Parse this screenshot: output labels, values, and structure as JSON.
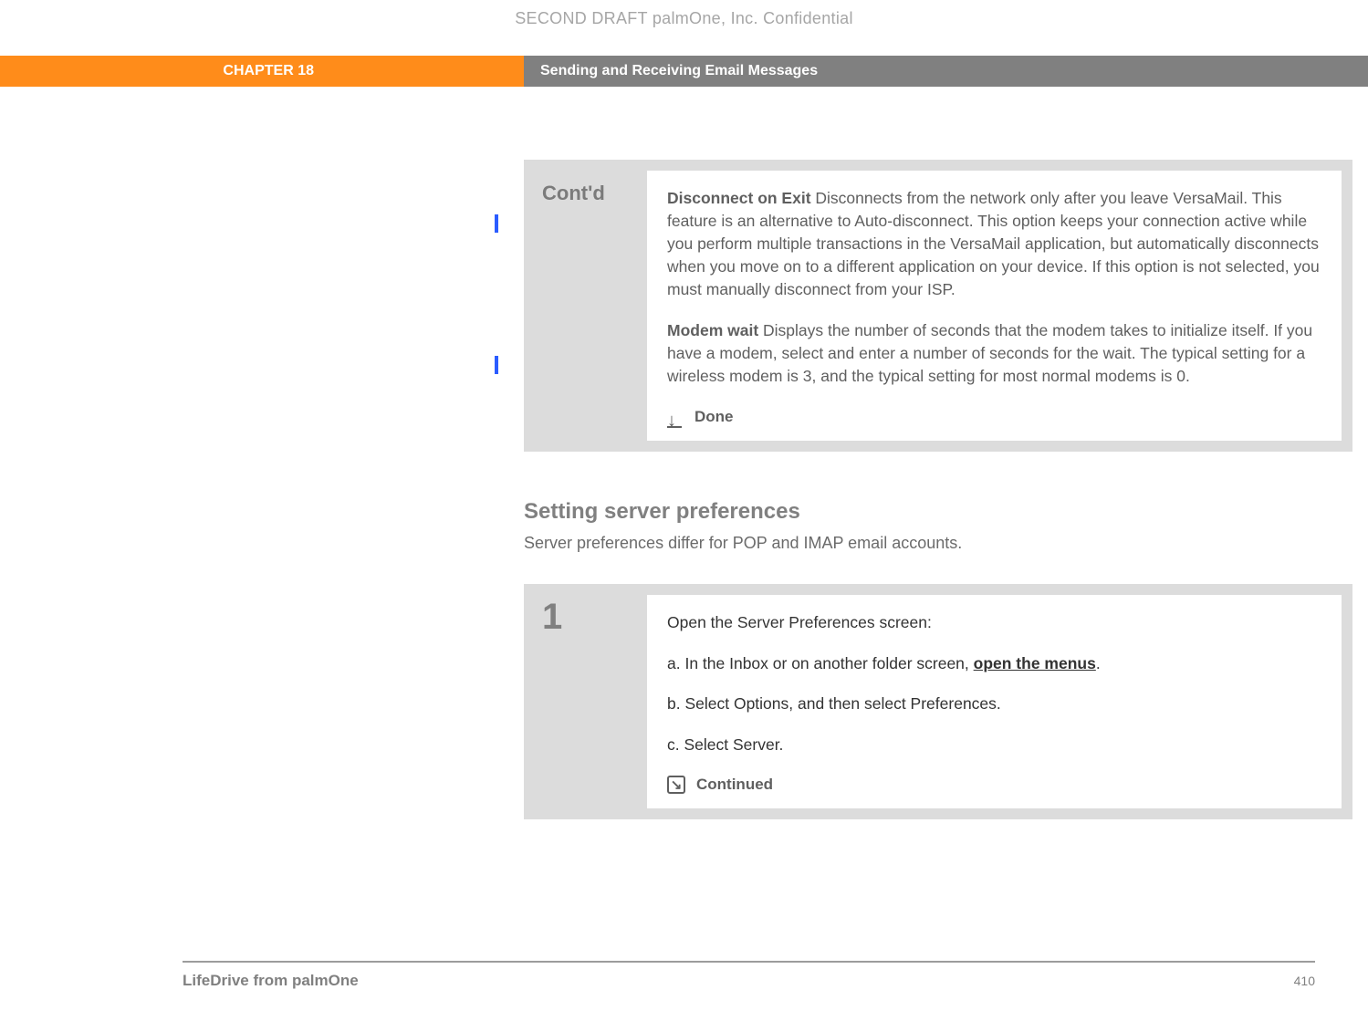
{
  "header": {
    "confidential": "SECOND DRAFT palmOne, Inc.  Confidential",
    "chapter": "CHAPTER 18",
    "title": "Sending and Receiving Email Messages"
  },
  "callout": {
    "label": "Cont'd",
    "para1_strong": "Disconnect on Exit",
    "para1_text": "   Disconnects from the network only after you leave VersaMail. This feature is an alternative to Auto-disconnect. This option keeps your connection active while you perform multiple transactions in the VersaMail application, but automatically disconnects when you move on to a different application on your device. If this option is not selected, you must manually disconnect from your ISP.",
    "para2_strong": "Modem wait",
    "para2_text": "   Displays the number of seconds that the modem takes to initialize itself. If you have a modem, select and enter a number of seconds for the wait. The typical setting for a wireless modem is 3, and the typical setting for most normal modems is 0.",
    "done": "Done"
  },
  "section": {
    "heading": "Setting server preferences",
    "sub": "Server preferences differ for POP and IMAP email accounts."
  },
  "step": {
    "num": "1",
    "lead": "Open the Server Preferences screen:",
    "a_prefix": "a.  In the Inbox or on another folder screen, ",
    "a_link": "open the menus",
    "a_suffix": ".",
    "b": "b.  Select Options, and then select Preferences.",
    "c": "c.  Select Server.",
    "continued": "Continued"
  },
  "footer": {
    "brand": "LifeDrive from palmOne",
    "page": "410"
  }
}
